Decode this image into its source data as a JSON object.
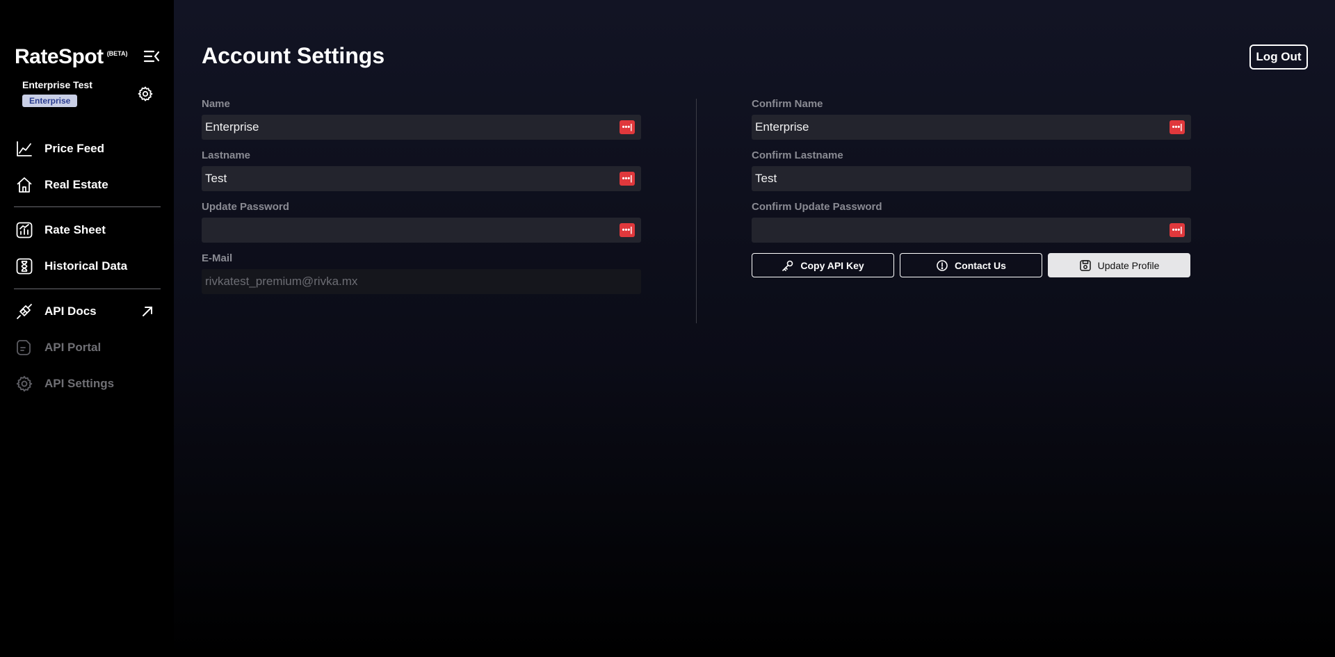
{
  "sidebar": {
    "brand": "RateSpot",
    "beta": "(BETA)",
    "user": {
      "name": "Enterprise Test",
      "plan": "Enterprise"
    },
    "nav": [
      {
        "label": "Price Feed",
        "icon": "line-chart-icon",
        "enabled": true
      },
      {
        "label": "Real Estate",
        "icon": "home-icon",
        "enabled": true
      },
      {
        "label": "Rate Sheet",
        "icon": "bar-chart-icon",
        "enabled": true
      },
      {
        "label": "Historical Data",
        "icon": "hourglass-icon",
        "enabled": true
      },
      {
        "label": "API Docs",
        "icon": "plug-icon",
        "enabled": true,
        "external": true
      },
      {
        "label": "API Portal",
        "icon": "document-icon",
        "enabled": false
      },
      {
        "label": "API Settings",
        "icon": "gear-icon",
        "enabled": false
      }
    ]
  },
  "header": {
    "title": "Account Settings",
    "logout_label": "Log Out"
  },
  "form": {
    "left": {
      "name": {
        "label": "Name",
        "value": "Enterprise"
      },
      "lastname": {
        "label": "Lastname",
        "value": "Test"
      },
      "password": {
        "label": "Update Password",
        "value": ""
      },
      "email": {
        "label": "E-Mail",
        "value": "rivkatest_premium@rivka.mx"
      }
    },
    "right": {
      "confirm_name": {
        "label": "Confirm Name",
        "value": "Enterprise"
      },
      "confirm_lastname": {
        "label": "Confirm Lastname",
        "value": "Test"
      },
      "confirm_password": {
        "label": "Confirm Update Password",
        "value": ""
      }
    },
    "password_manager_glyph": "•••|"
  },
  "actions": {
    "copy_api_key": "Copy API Key",
    "contact_us": "Contact Us",
    "update_profile": "Update Profile"
  },
  "colors": {
    "accent_badge_bg": "#c9cfe6",
    "accent_badge_fg": "#2a3c8f",
    "password_icon": "#e0383c",
    "field_bg": "#23242d"
  }
}
